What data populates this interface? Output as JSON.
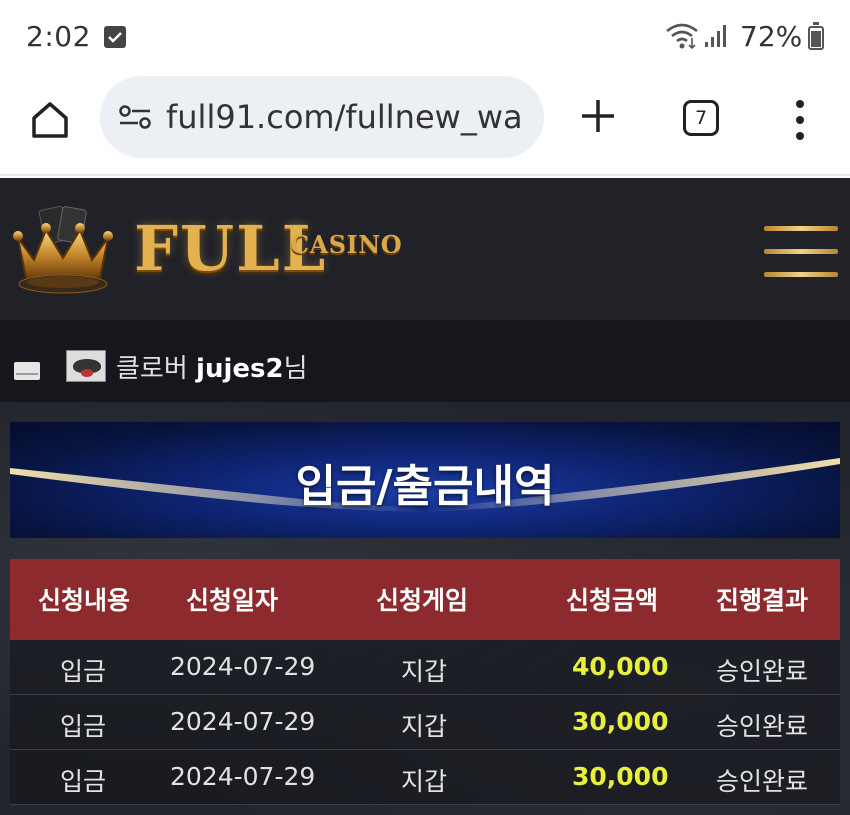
{
  "status_bar": {
    "time": "2:02",
    "battery": "72%"
  },
  "browser": {
    "url": "full91.com/fullnew_wa",
    "tab_count": "7"
  },
  "site": {
    "logo_main": "FULL",
    "logo_sub": "CASINO",
    "user": {
      "prefix": "클로버 ",
      "id": "jujes2",
      "suffix": "님"
    },
    "page_title": "입금/출금내역",
    "table": {
      "headers": [
        "신청내용",
        "신청일자",
        "신청게임",
        "신청금액",
        "진행결과"
      ],
      "rows": [
        {
          "type": "입금",
          "date": "2024-07-29",
          "game": "지갑",
          "amount": "40,000",
          "result": "승인완료"
        },
        {
          "type": "입금",
          "date": "2024-07-29",
          "game": "지갑",
          "amount": "30,000",
          "result": "승인완료"
        },
        {
          "type": "입금",
          "date": "2024-07-29",
          "game": "지갑",
          "amount": "30,000",
          "result": "승인완료"
        }
      ]
    },
    "colors": {
      "header_bg": "#202228",
      "table_head": "#8d2a2d",
      "amount": "#e8f03c",
      "banner": "#0e2472",
      "gold": "#e3b24e"
    }
  }
}
